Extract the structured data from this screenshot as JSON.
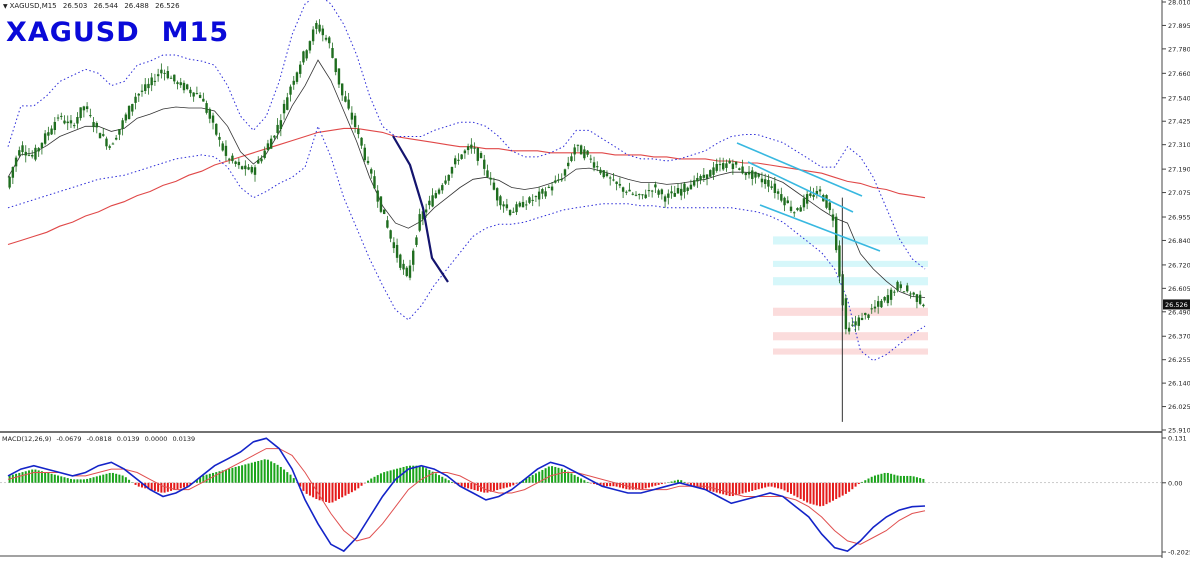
{
  "header": {
    "symbol_tf": "XAGUSD,M15",
    "ohlc": [
      "26.503",
      "26.544",
      "26.488",
      "26.526"
    ]
  },
  "overlay_title": {
    "symbol": "XAGUSD",
    "timeframe": "M15"
  },
  "macd": {
    "label": "MACD(12,26,9)",
    "values": [
      "-0.0679",
      "-0.0818",
      "0.0139",
      "0.0000",
      "0.0139"
    ]
  },
  "colors": {
    "bg": "#ffffff",
    "candle": "#1f6d1f",
    "bollinger": "#2a2ad8",
    "ma_long": "#e04848",
    "ma_mid": "#333333",
    "trendline": "#38b8e0",
    "zone_blue": "#d6f7fa",
    "zone_red": "#fbdcdc",
    "hist_up": "#1aa41a",
    "hist_down": "#e41a1a",
    "macd_line": "#1424c8",
    "signal_line": "#e05050"
  },
  "chart_data": [
    {
      "type": "candlestick",
      "title": "",
      "xlabel": "",
      "ylabel": "",
      "ylim": [
        25.91,
        28.01
      ],
      "y_ticks": [
        "28.010",
        "27.895",
        "27.780",
        "27.660",
        "27.540",
        "27.425",
        "27.310",
        "27.190",
        "27.075",
        "26.955",
        "26.840",
        "26.720",
        "26.605",
        "26.490",
        "26.370",
        "26.255",
        "26.140",
        "26.025",
        "25.910"
      ],
      "current_price": "26.526",
      "indicators": [
        "Bollinger Bands",
        "Moving Average (mid)",
        "Moving Average (long)"
      ],
      "series": [
        {
          "name": "",
          "role": "close",
          "values": [
            27.1,
            27.3,
            27.25,
            27.35,
            27.45,
            27.4,
            27.5,
            27.38,
            27.3,
            27.42,
            27.55,
            27.6,
            27.68,
            27.62,
            27.58,
            27.55,
            27.4,
            27.25,
            27.2,
            27.18,
            27.28,
            27.4,
            27.6,
            27.75,
            27.9,
            27.8,
            27.55,
            27.4,
            27.2,
            27.0,
            26.8,
            26.65,
            26.95,
            27.05,
            27.15,
            27.25,
            27.3,
            27.2,
            27.05,
            26.98,
            27.02,
            27.05,
            27.1,
            27.15,
            27.3,
            27.25,
            27.18,
            27.12,
            27.08,
            27.05,
            27.1,
            27.05,
            27.08,
            27.12,
            27.15,
            27.2,
            27.22,
            27.18,
            27.15,
            27.12,
            27.05,
            26.98,
            27.05,
            27.08,
            26.95,
            26.4,
            26.45,
            26.5,
            26.55,
            26.62,
            26.58,
            26.53
          ]
        },
        {
          "name": "",
          "role": "upper band",
          "values": [
            27.3,
            27.5,
            27.5,
            27.55,
            27.62,
            27.65,
            27.68,
            27.66,
            27.6,
            27.62,
            27.7,
            27.72,
            27.75,
            27.75,
            27.73,
            27.72,
            27.7,
            27.6,
            27.45,
            27.38,
            27.45,
            27.62,
            27.85,
            28.0,
            28.05,
            28.0,
            27.9,
            27.75,
            27.55,
            27.4,
            27.35,
            27.35,
            27.35,
            27.38,
            27.4,
            27.42,
            27.42,
            27.4,
            27.35,
            27.28,
            27.25,
            27.25,
            27.27,
            27.3,
            27.38,
            27.38,
            27.34,
            27.3,
            27.26,
            27.24,
            27.24,
            27.23,
            27.24,
            27.26,
            27.28,
            27.32,
            27.35,
            27.36,
            27.36,
            27.34,
            27.32,
            27.28,
            27.24,
            27.2,
            27.2,
            27.3,
            27.25,
            27.15,
            27.0,
            26.85,
            26.75,
            26.7
          ]
        },
        {
          "name": "",
          "role": "lower band",
          "values": [
            27.0,
            27.02,
            27.04,
            27.06,
            27.08,
            27.1,
            27.12,
            27.14,
            27.15,
            27.16,
            27.18,
            27.2,
            27.22,
            27.24,
            27.25,
            27.26,
            27.25,
            27.2,
            27.1,
            27.05,
            27.08,
            27.12,
            27.15,
            27.2,
            27.4,
            27.25,
            27.05,
            26.9,
            26.75,
            26.62,
            26.5,
            26.45,
            26.52,
            26.62,
            26.7,
            26.78,
            26.86,
            26.9,
            26.92,
            26.92,
            26.93,
            26.95,
            26.97,
            26.99,
            27.0,
            27.01,
            27.02,
            27.02,
            27.02,
            27.01,
            27.01,
            27.0,
            27.0,
            27.0,
            27.0,
            27.0,
            27.0,
            26.99,
            26.98,
            26.96,
            26.93,
            26.88,
            26.83,
            26.78,
            26.7,
            26.55,
            26.3,
            26.25,
            26.28,
            26.33,
            26.38,
            26.42
          ]
        },
        {
          "name": "",
          "role": "long moving average",
          "values": [
            26.82,
            26.84,
            26.86,
            26.88,
            26.91,
            26.93,
            26.96,
            26.98,
            27.01,
            27.03,
            27.06,
            27.08,
            27.11,
            27.13,
            27.16,
            27.18,
            27.21,
            27.23,
            27.25,
            27.27,
            27.29,
            27.31,
            27.33,
            27.35,
            27.37,
            27.38,
            27.39,
            27.39,
            27.38,
            27.37,
            27.35,
            27.34,
            27.33,
            27.32,
            27.31,
            27.3,
            27.3,
            27.29,
            27.29,
            27.28,
            27.28,
            27.28,
            27.27,
            27.27,
            27.27,
            27.27,
            27.27,
            27.26,
            27.26,
            27.26,
            27.25,
            27.25,
            27.24,
            27.24,
            27.24,
            27.23,
            27.23,
            27.22,
            27.22,
            27.21,
            27.2,
            27.19,
            27.18,
            27.17,
            27.15,
            27.13,
            27.12,
            27.1,
            27.09,
            27.07,
            27.06,
            27.05
          ]
        }
      ],
      "zones": [
        {
          "kind": "resistance",
          "color": "blue",
          "range": [
            26.82,
            26.86
          ]
        },
        {
          "kind": "resistance",
          "color": "blue",
          "range": [
            26.71,
            26.74
          ]
        },
        {
          "kind": "resistance",
          "color": "blue",
          "range": [
            26.62,
            26.66
          ]
        },
        {
          "kind": "support",
          "color": "red",
          "range": [
            26.47,
            26.51
          ]
        },
        {
          "kind": "support",
          "color": "red",
          "range": [
            26.35,
            26.39
          ]
        },
        {
          "kind": "support",
          "color": "red",
          "range": [
            26.28,
            26.31
          ]
        }
      ]
    },
    {
      "type": "bar",
      "title": "",
      "ylim": [
        -0.2025,
        0.131
      ],
      "y_ticks": [
        "0.131",
        "0.00",
        "-0.2025"
      ],
      "series": [
        {
          "name": "",
          "role": "histogram",
          "values": [
            0.02,
            0.03,
            0.04,
            0.03,
            0.02,
            0.01,
            0.01,
            0.02,
            0.03,
            0.02,
            -0.01,
            -0.02,
            -0.03,
            -0.02,
            -0.01,
            0.02,
            0.03,
            0.04,
            0.05,
            0.06,
            0.07,
            0.05,
            0.02,
            -0.03,
            -0.05,
            -0.06,
            -0.04,
            -0.02,
            0.01,
            0.03,
            0.04,
            0.05,
            0.05,
            0.03,
            0.01,
            -0.01,
            -0.02,
            -0.03,
            -0.02,
            -0.01,
            0.01,
            0.03,
            0.05,
            0.04,
            0.02,
            0.0,
            -0.01,
            -0.01,
            -0.02,
            -0.02,
            -0.01,
            0.0,
            0.01,
            -0.01,
            -0.02,
            -0.03,
            -0.04,
            -0.03,
            -0.02,
            -0.01,
            -0.02,
            -0.04,
            -0.06,
            -0.07,
            -0.05,
            -0.03,
            0.0,
            0.02,
            0.03,
            0.02,
            0.02,
            0.01
          ]
        },
        {
          "name": "",
          "role": "macd",
          "values": [
            0.02,
            0.04,
            0.05,
            0.04,
            0.03,
            0.02,
            0.03,
            0.05,
            0.06,
            0.04,
            0.01,
            -0.02,
            -0.04,
            -0.03,
            -0.01,
            0.02,
            0.05,
            0.07,
            0.09,
            0.12,
            0.13,
            0.1,
            0.04,
            -0.05,
            -0.12,
            -0.18,
            -0.2,
            -0.16,
            -0.1,
            -0.04,
            0.01,
            0.04,
            0.05,
            0.04,
            0.02,
            -0.01,
            -0.03,
            -0.05,
            -0.04,
            -0.02,
            0.01,
            0.04,
            0.06,
            0.05,
            0.03,
            0.01,
            -0.01,
            -0.02,
            -0.03,
            -0.03,
            -0.02,
            -0.01,
            0.0,
            -0.01,
            -0.02,
            -0.04,
            -0.06,
            -0.05,
            -0.04,
            -0.03,
            -0.04,
            -0.07,
            -0.1,
            -0.15,
            -0.19,
            -0.2,
            -0.17,
            -0.13,
            -0.1,
            -0.08,
            -0.07,
            -0.068
          ]
        },
        {
          "name": "",
          "role": "signal",
          "values": [
            0.01,
            0.02,
            0.03,
            0.03,
            0.03,
            0.02,
            0.02,
            0.03,
            0.04,
            0.04,
            0.03,
            0.01,
            -0.01,
            -0.02,
            -0.02,
            0.0,
            0.02,
            0.04,
            0.06,
            0.08,
            0.1,
            0.1,
            0.08,
            0.03,
            -0.03,
            -0.09,
            -0.14,
            -0.17,
            -0.16,
            -0.12,
            -0.07,
            -0.02,
            0.01,
            0.03,
            0.03,
            0.02,
            0.0,
            -0.02,
            -0.03,
            -0.03,
            -0.02,
            0.0,
            0.02,
            0.03,
            0.03,
            0.02,
            0.01,
            0.0,
            -0.01,
            -0.02,
            -0.02,
            -0.02,
            -0.01,
            -0.01,
            -0.01,
            -0.02,
            -0.03,
            -0.04,
            -0.04,
            -0.04,
            -0.04,
            -0.05,
            -0.07,
            -0.1,
            -0.14,
            -0.17,
            -0.18,
            -0.16,
            -0.14,
            -0.11,
            -0.09,
            -0.082
          ]
        }
      ]
    }
  ]
}
